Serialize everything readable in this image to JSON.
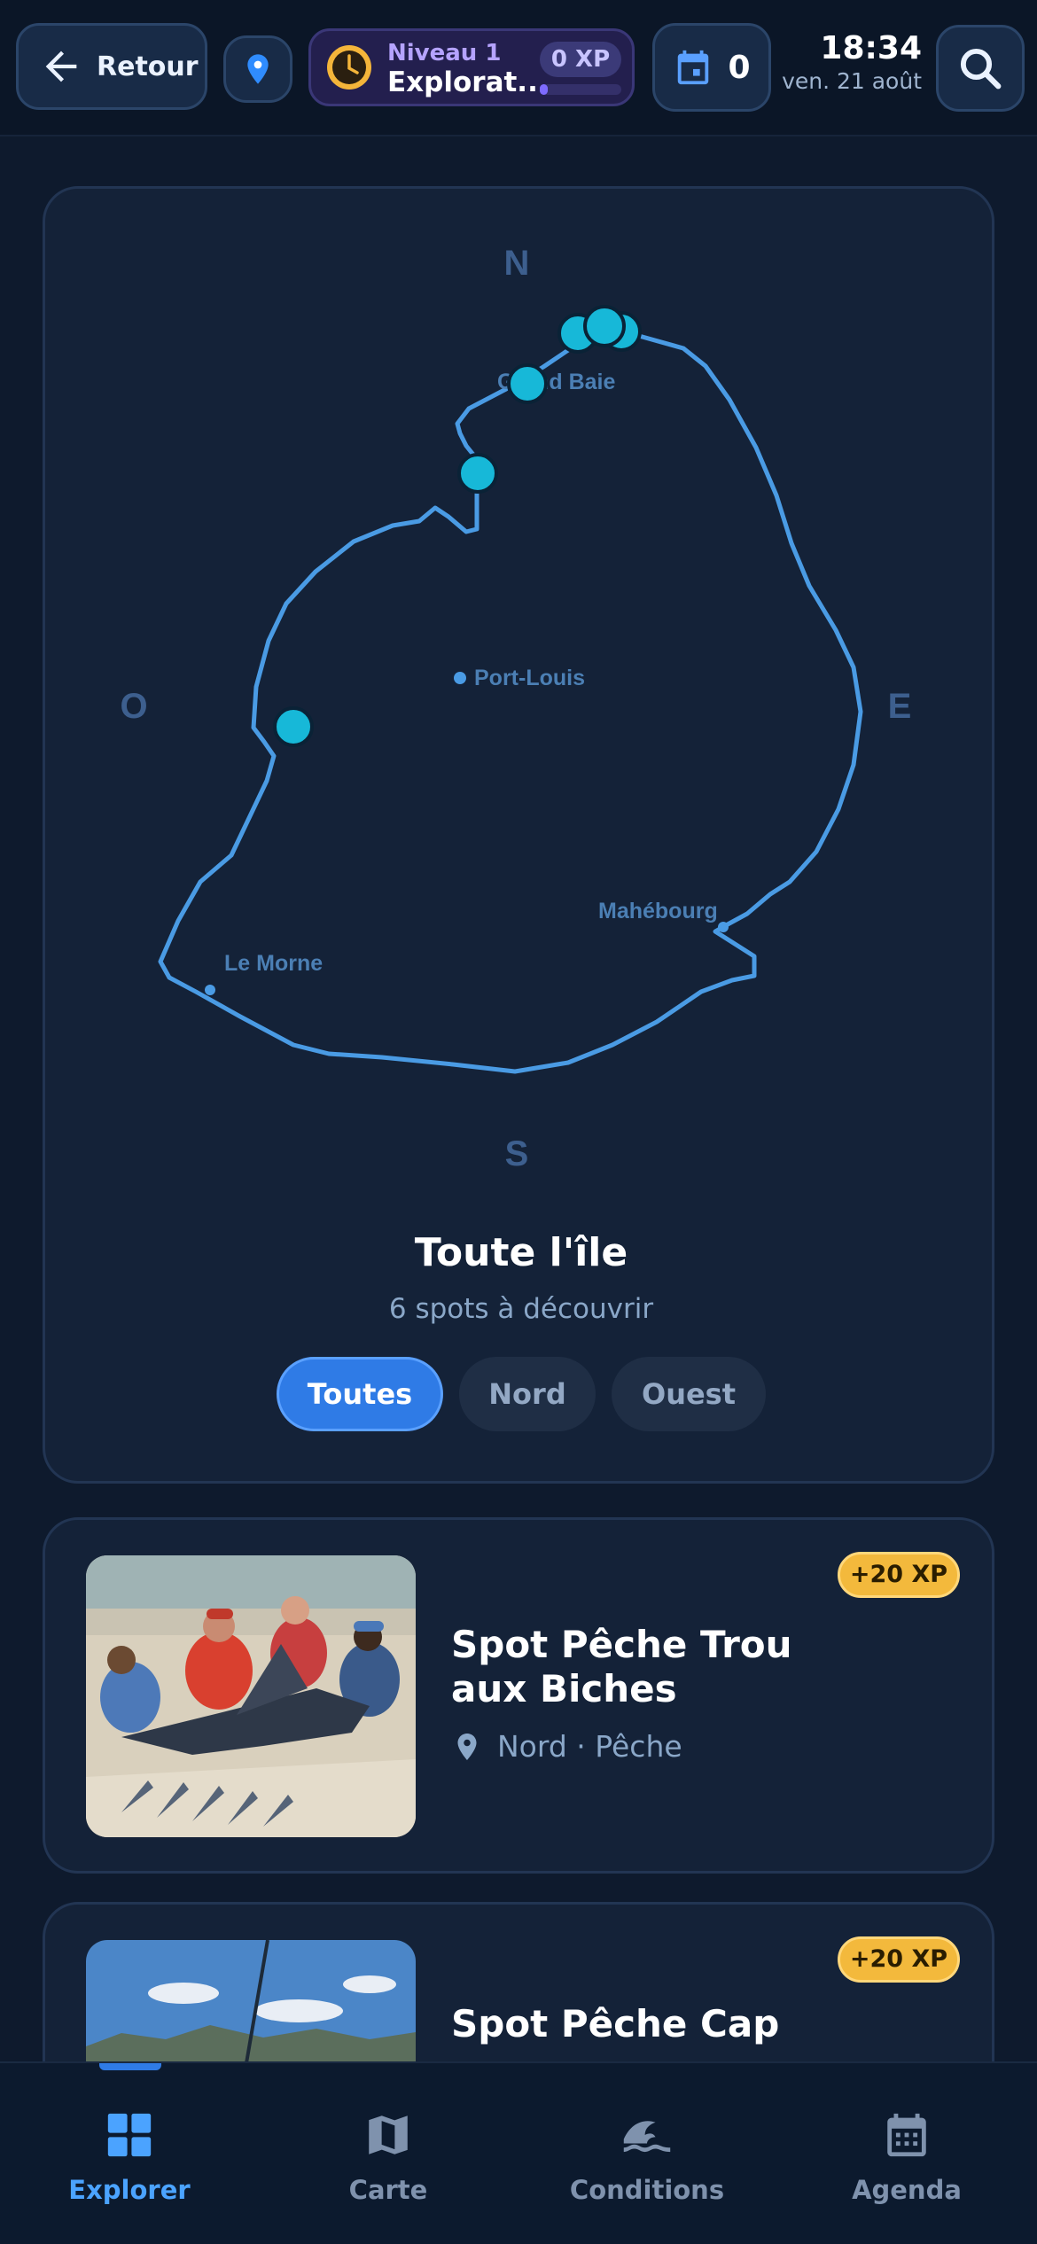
{
  "header": {
    "back_label": "Retour",
    "level_label": "Niveau 1",
    "level_name": "Explorat...",
    "xp_value": "0 XP",
    "xp_progress": 0.1,
    "agenda_count": "0",
    "time": "18:34",
    "date": "ven. 21 août"
  },
  "map": {
    "compass": {
      "north": "N",
      "south": "S",
      "east": "E",
      "west": "O"
    },
    "places": [
      "Grand Baie",
      "Port-Louis",
      "Mahébourg",
      "Le Morne"
    ],
    "region_title": "Toute l'île",
    "region_subtitle": "6 spots à découvrir",
    "filters": [
      "Toutes",
      "Nord",
      "Ouest"
    ],
    "active_filter": "Toutes"
  },
  "spots": [
    {
      "title": "Spot Pêche Trou aux Biches",
      "meta": "Nord · Pêche",
      "xp": "+20 XP"
    },
    {
      "title": "Spot Pêche Cap",
      "xp": "+20 XP"
    }
  ],
  "nav": [
    {
      "label": "Explorer",
      "icon": "grid-icon"
    },
    {
      "label": "Carte",
      "icon": "map-icon"
    },
    {
      "label": "Conditions",
      "icon": "wave-icon"
    },
    {
      "label": "Agenda",
      "icon": "calendar-icon"
    }
  ],
  "colors": {
    "accent": "#2f7be6",
    "marker": "#17b8d8",
    "xp_gold": "#f3b93c",
    "background": "#0e1a2d"
  }
}
